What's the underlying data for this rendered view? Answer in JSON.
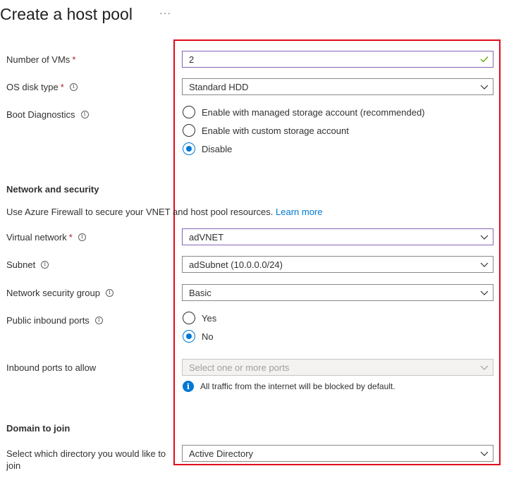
{
  "page": {
    "title": "Create a host pool",
    "more": "···"
  },
  "fields": {
    "vms": {
      "label": "Number of VMs",
      "required": "*",
      "value": "2"
    },
    "os_disk": {
      "label": "OS disk type",
      "required": "*",
      "info": "i",
      "value": "Standard HDD"
    },
    "boot": {
      "label": "Boot Diagnostics",
      "info": "i",
      "options": [
        "Enable with managed storage account (recommended)",
        "Enable with custom storage account",
        "Disable"
      ],
      "selected": "Disable"
    }
  },
  "network": {
    "heading": "Network and security",
    "firewall_text": "Use Azure Firewall to secure your VNET and host pool resources.",
    "learn_more": "Learn more",
    "vnet": {
      "label": "Virtual network",
      "required": "*",
      "info": "i",
      "value": "adVNET"
    },
    "subnet": {
      "label": "Subnet",
      "info": "i",
      "value": "adSubnet (10.0.0.0/24)"
    },
    "nsg": {
      "label": "Network security group",
      "info": "i",
      "value": "Basic"
    },
    "inbound": {
      "label": "Public inbound ports",
      "info": "i",
      "options": [
        "Yes",
        "No"
      ],
      "selected": "No"
    },
    "ports": {
      "label": "Inbound ports to allow",
      "placeholder": "Select one or more ports",
      "notice_icon": "i",
      "notice": "All traffic from the internet will be blocked by default."
    }
  },
  "domain": {
    "heading": "Domain to join",
    "directory": {
      "label": "Select which directory you would like to join",
      "value": "Active Directory"
    }
  },
  "colors": {
    "highlight_border": "#e00b1c",
    "accent": "#0078d4",
    "focus_border": "#8764b8",
    "valid_check": "#57a300",
    "required": "#a4262c"
  },
  "icons": {
    "dropdown": "chevron-down-icon",
    "valid": "checkmark-icon",
    "info": "info-icon",
    "notice": "info-filled-icon"
  }
}
